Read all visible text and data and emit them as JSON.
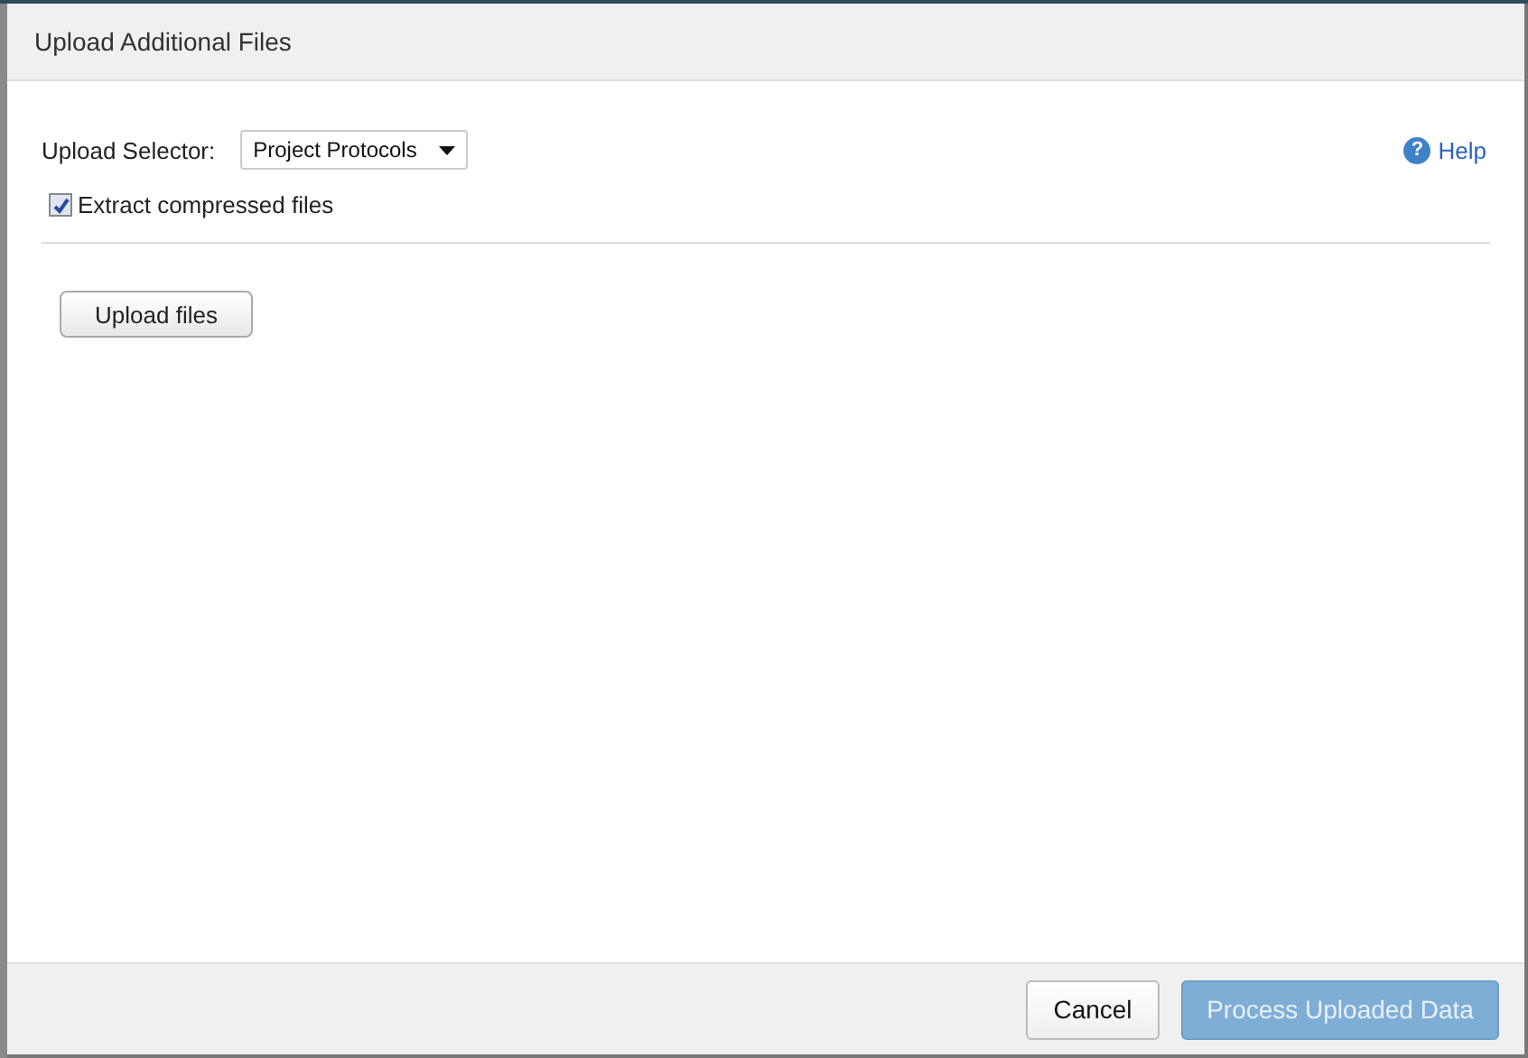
{
  "window": {
    "title": "Upload Additional Files"
  },
  "upload_selector": {
    "label": "Upload Selector:",
    "value": "Project Protocols"
  },
  "help": {
    "icon": "?",
    "label": "Help"
  },
  "extract_checkbox": {
    "label": "Extract compressed files",
    "checked": true
  },
  "upload_button": {
    "label": "Upload files"
  },
  "buttons": [
    {
      "label": "Cancel",
      "kind": "default",
      "disabled": false
    },
    {
      "label": "Process Uploaded Data",
      "kind": "primary",
      "disabled": true
    }
  ]
}
